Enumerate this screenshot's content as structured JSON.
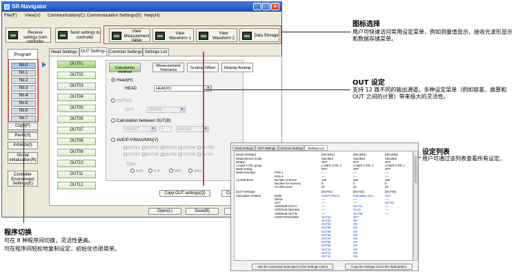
{
  "window": {
    "title": "SR-Navigator"
  },
  "menu": [
    "File(F)",
    "View(V)",
    "Communication(C)",
    "Communication Settings(S)",
    "Help(H)"
  ],
  "toolbar": {
    "receive": "Receive settings from controller",
    "send": "Send settings to controller",
    "view_measurement": "View Measurement Value",
    "view_waveform1": "View Waveform 1",
    "view_waveform2": "View Waveform 2",
    "data_storage": "Data Storage"
  },
  "program_panel": {
    "heading": "Program",
    "items": [
      "No.0",
      "No.1",
      "No.2",
      "No.3",
      "No.4",
      "No.5",
      "No.6",
      "No.7"
    ],
    "copy": "Copy(P)",
    "paste": "Paste(S)",
    "initialize": "Initialize(I)",
    "global_init": "Global initialization(R)",
    "controller_env": "Controller Environment Settings(E)"
  },
  "tabs": [
    "Head Settings",
    "OUT Settings",
    "Common Settings",
    "Settings List"
  ],
  "outs": [
    "OUT01",
    "OUT02",
    "OUT03",
    "OUT04",
    "OUT05",
    "OUT06",
    "OUT07",
    "OUT08",
    "OUT09",
    "OUT10",
    "OUT11",
    "OUT12"
  ],
  "modes": [
    "Calculation method",
    "Measurement Tolerance",
    "Scaling Offset",
    "Display Analog"
  ],
  "calc": {
    "head_opt": "Head(H)",
    "head_label": "HEAD",
    "head_value": "HEAD01",
    "out_opt": "OUT(O)",
    "out_label": "OUT",
    "out_value": "OUT02",
    "between_opt": "Calculation between OUT(B)",
    "between_a": "OUT01",
    "op": "+",
    "between_b": "OUT12",
    "ave_opt": "AVE/P-P/MAX/MIN(V)",
    "checks": [
      "OUT01",
      "OUT02",
      "OUT03",
      "OUT04",
      "OUT05",
      "OUT06",
      "OUT07",
      "OUT08",
      "OUT09",
      "OUT10",
      "OUT11",
      "OUT12"
    ],
    "type_label": "Type",
    "types": [
      "AVE",
      "P-P",
      "MIN",
      "MAX"
    ],
    "copy_out": "Copy OUT settings(Q)",
    "more": "Co"
  },
  "footer": {
    "open": "Open(L)",
    "save": "Save(B)",
    "exit": "Exit"
  },
  "annotations": {
    "icon_title": "图标选择",
    "icon_body": "用户可快速访问常用设定菜单，例如测量值显示、接收光波形显示和数据存储菜单。",
    "out_title": "OUT 设定",
    "out_body": "支持 12 路不同的输出通道。多种设定菜单（例如容差、换算和 OUT 之间的计算）带来极大的灵活性。",
    "list_title": "设定列表",
    "list_body": "用户可通过该列表查看所有设定。",
    "prog_title": "程序切换",
    "prog_body1": "可在 8 种程序间切换，灵活性更高。",
    "prog_body2": "可在程序间轻松地复制设定，初始化也很简单。"
  },
  "settings_list": {
    "tabs": [
      "Head Settings",
      "OUT Settings",
      "Common Settings",
      "Settings List"
    ],
    "head_cols": [
      "[Head Settings]",
      "[HEAD01]",
      "[HEAD02]",
      "[HEAD03]"
    ],
    "head_rows": [
      [
        "Measurement mode",
        "",
        "Standard",
        "Standard",
        "Standard"
      ],
      [
        "Median",
        "",
        "OFF",
        "OFF",
        "OFF"
      ],
      [
        "LASER CTRL group",
        "",
        "LASER CTRL 1",
        "LASER CTRL 1",
        "LASER CTRL 1"
      ],
      [
        "Mask setting",
        "",
        "OFF",
        "OFF",
        "OFF"
      ],
      [
        "Mask boundary",
        "POS-1",
        "----",
        "----",
        "----"
      ],
      [
        "",
        "POS-2",
        "----",
        "----",
        "----"
      ],
      [
        "ALARM Error",
        "Number of Errors",
        "100",
        "100",
        "100"
      ],
      [
        "",
        "Number for recovery",
        "8",
        "8",
        "8"
      ],
      [
        "",
        "ALARM Level",
        "32",
        "32",
        "32"
      ]
    ],
    "out_cols": [
      "[OUT Settings]",
      "[OUT01]",
      "[OUT02]",
      "[OUT03]"
    ],
    "out_rows": [
      [
        "Calculation method",
        "Mode",
        "AVE/P-P/MAX...",
        "Calculation bet...",
        "OUT"
      ],
      [
        "",
        "HEAD",
        "----",
        "----",
        "----"
      ],
      [
        "",
        "OUT",
        "----",
        "----",
        "OUT01"
      ],
      [
        "",
        "ADD/SUB OUT-A",
        "----",
        "OUT01",
        "----"
      ],
      [
        "",
        "ADD/SUB Operator",
        "----",
        "PLUS",
        "----"
      ],
      [
        "",
        "ADD/SUB OUT-B",
        "----",
        "OUT05",
        "----"
      ],
      [
        "",
        "AVE/P-P/MAX/MIN",
        "OUT01",
        "OFF",
        ""
      ],
      [
        "",
        "",
        "OUT02",
        "ON",
        ""
      ],
      [
        "",
        "",
        "OUT03",
        "ON",
        ""
      ],
      [
        "",
        "",
        "OUT04",
        "ON",
        ""
      ],
      [
        "",
        "",
        "OUT05",
        "ON",
        ""
      ],
      [
        "",
        "",
        "OUT06",
        "ON",
        ""
      ],
      [
        "",
        "",
        "OUT07",
        "ON",
        ""
      ],
      [
        "",
        "",
        "OUT08",
        "ON",
        ""
      ],
      [
        "",
        "",
        "OUT09",
        "ON",
        ""
      ],
      [
        "",
        "",
        "OUT10",
        "ON",
        ""
      ],
      [
        "",
        "",
        "OUT11",
        "ON",
        ""
      ],
      [
        "",
        "",
        "OUT12",
        "ON",
        ""
      ]
    ],
    "btn_add": "Add the connected head types to the Settings List(A)",
    "btn_copy": "Copy the Settings List to the clipboard(C)"
  },
  "colors": {
    "highlight": "#e23b3b",
    "title_bar": "#1f4fb0",
    "out_selected": "#96d36b"
  }
}
